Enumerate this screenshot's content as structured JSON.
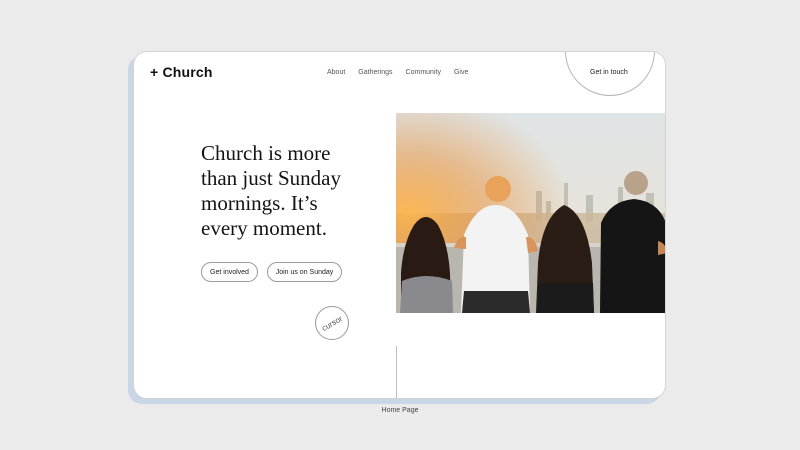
{
  "site": {
    "logo": "+ Church"
  },
  "nav": {
    "items": [
      "About",
      "Gatherings",
      "Community",
      "Give"
    ],
    "cta_label": "Get in touch"
  },
  "hero": {
    "headline_lines": [
      "Church is more",
      "than just Sunday",
      "mornings. It’s",
      "every moment."
    ],
    "buttons": {
      "primary_label": "Get involved",
      "secondary_label": "Join us on Sunday"
    },
    "badge_label": "cursor",
    "photo_icon": "group-photo-icon"
  },
  "caption": "Home Page",
  "colors": {
    "background": "#ebebeb",
    "card": "#ffffff",
    "shadow_accent": "#c8d6e6",
    "text": "#141414"
  }
}
